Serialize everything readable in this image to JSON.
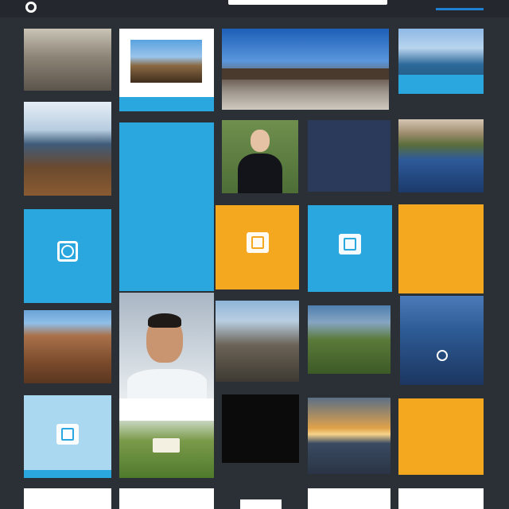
{
  "header": {
    "logo_text": "",
    "search_placeholder": "",
    "right_text": ""
  },
  "tiles": {
    "t1_caption": "",
    "t2_caption": "",
    "t3_caption": "",
    "t4_caption": "",
    "t5_caption": "",
    "t6_title": "",
    "t6_sub": "",
    "t7_title": "",
    "t7_sub": "",
    "t8_caption": "",
    "t9_title": "",
    "t9_sub": "",
    "t10_title": "",
    "t10_sub": "",
    "t11_title": "",
    "t11_sub": "",
    "t12_title": "",
    "t13_caption": "",
    "t14_caption": "",
    "t15_title": "",
    "t16_title": "",
    "t16_sub": "",
    "t17_sub": "",
    "t18_title": "",
    "t18_sub": ""
  },
  "colors": {
    "background": "#2b2f36",
    "cyan": "#2aa7de",
    "orange": "#f4a81f",
    "navy": "#2b3a5a"
  },
  "icons": [
    "logo-ring-icon",
    "app-ring-icon",
    "app-square-icon",
    "app-square-icon",
    "badge-icon"
  ]
}
